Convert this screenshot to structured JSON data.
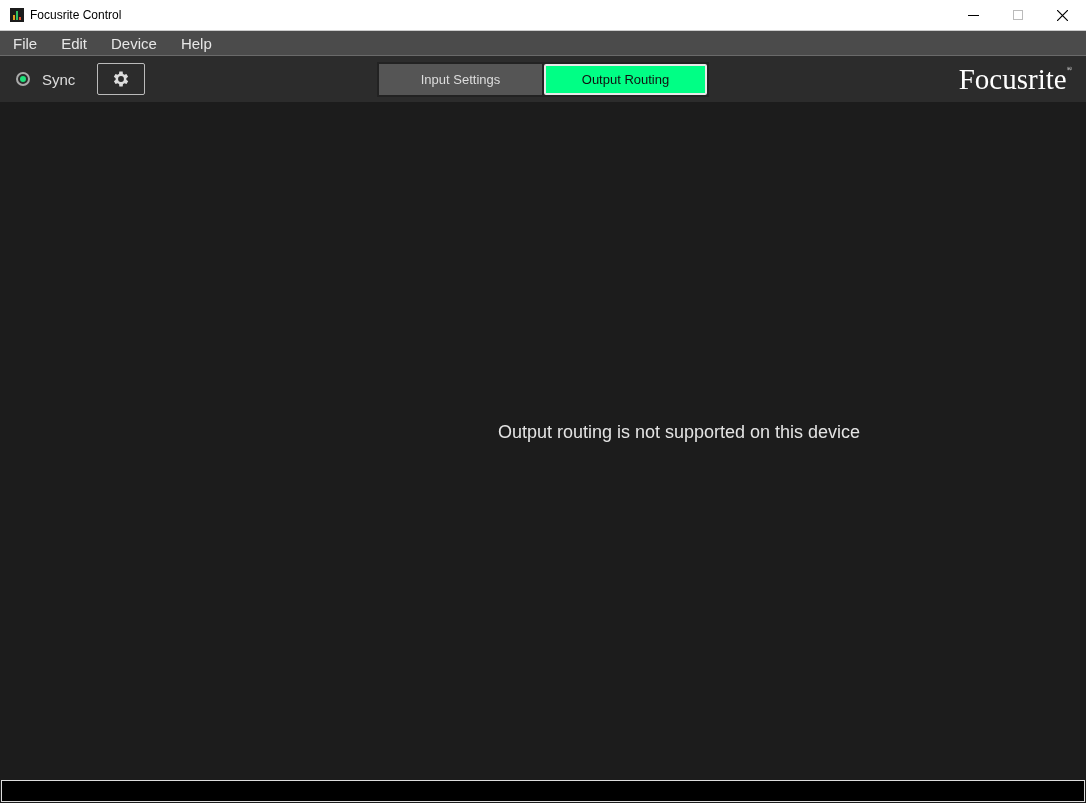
{
  "window": {
    "title": "Focusrite Control"
  },
  "menu": [
    "File",
    "Edit",
    "Device",
    "Help"
  ],
  "sync": {
    "label": "Sync",
    "on": true
  },
  "tabs": [
    {
      "label": "Input Settings",
      "selected": false
    },
    {
      "label": "Output Routing",
      "selected": true
    }
  ],
  "logo": "Focusrite$^{®}$",
  "message": "Output routing is not supported on this device"
}
